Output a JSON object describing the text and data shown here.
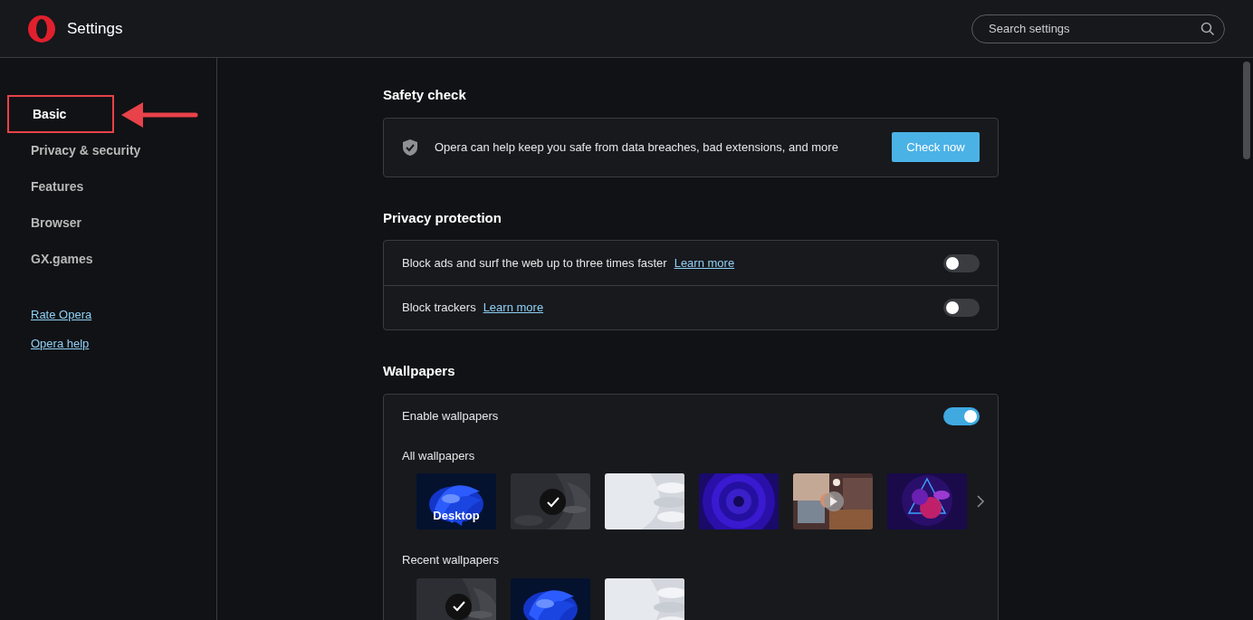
{
  "header": {
    "title": "Settings",
    "search": {
      "placeholder": "Search settings"
    }
  },
  "sidebar": {
    "items": [
      {
        "label": "Basic",
        "selected": true,
        "annotated": true
      },
      {
        "label": "Privacy & security",
        "selected": false,
        "annotated": false
      },
      {
        "label": "Features",
        "selected": false,
        "annotated": false
      },
      {
        "label": "Browser",
        "selected": false,
        "annotated": false
      },
      {
        "label": "GX.games",
        "selected": false,
        "annotated": false
      }
    ],
    "links": [
      "Rate Opera",
      "Opera help"
    ]
  },
  "safety_check": {
    "title": "Safety check",
    "message": "Opera can help keep you safe from data breaches, bad extensions, and more",
    "button": "Check now"
  },
  "privacy_protection": {
    "title": "Privacy protection",
    "rows": [
      {
        "text": "Block ads and surf the web up to three times faster",
        "link": "Learn more",
        "on": false
      },
      {
        "text": "Block trackers",
        "link": "Learn more",
        "on": false
      }
    ]
  },
  "wallpapers": {
    "title": "Wallpapers",
    "enable": {
      "label": "Enable wallpapers",
      "on": true
    },
    "groups": [
      {
        "title": "All wallpapers",
        "items": [
          {
            "kind": "picture",
            "label": "Desktop",
            "selected": false,
            "video": false
          },
          {
            "kind": "picture",
            "selected": true,
            "video": false
          },
          {
            "kind": "picture",
            "selected": false,
            "video": false
          },
          {
            "kind": "picture",
            "selected": false,
            "video": false
          },
          {
            "kind": "picture",
            "selected": false,
            "video": true
          },
          {
            "kind": "picture",
            "selected": false,
            "video": false
          }
        ],
        "more": true
      },
      {
        "title": "Recent wallpapers",
        "items": [
          {
            "kind": "picture",
            "selected": true,
            "video": false
          },
          {
            "kind": "picture",
            "selected": false,
            "video": false
          },
          {
            "kind": "picture",
            "selected": false,
            "video": false
          }
        ],
        "more": false
      }
    ]
  }
}
